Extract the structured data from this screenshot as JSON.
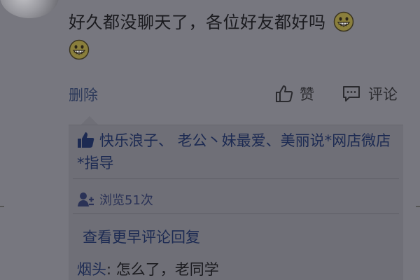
{
  "post": {
    "text": "好久都没聊天了，各位好友都好吗",
    "emoji_icon": "grinning-face-emoji"
  },
  "actions": {
    "delete_label": "删除",
    "like_label": "赞",
    "comment_label": "评论"
  },
  "likes": {
    "names": "快乐浪子、  老公丶妹最爱、美丽说*网店微店*指导"
  },
  "views": {
    "label": "浏览51次"
  },
  "comments": {
    "view_earlier_label": "查看更早评论回复",
    "items": [
      {
        "author": "烟头",
        "separator": ": ",
        "text": "怎么了，老同学"
      }
    ]
  },
  "colors": {
    "background_dim": "#77777f",
    "link": "#1c2a52",
    "text": "#1a1a1e"
  }
}
